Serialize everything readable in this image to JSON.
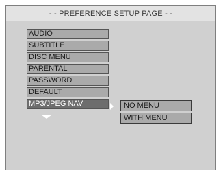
{
  "page_title": "- - PREFERENCE SETUP PAGE - -",
  "menu": {
    "items": [
      {
        "label": "AUDIO"
      },
      {
        "label": "SUBTITLE"
      },
      {
        "label": "DISC MENU"
      },
      {
        "label": "PARENTAL"
      },
      {
        "label": "PASSWORD"
      },
      {
        "label": "DEFAULT"
      },
      {
        "label": "MP3/JPEG NAV"
      }
    ],
    "selected_label": "MP3/JPEG NAV"
  },
  "submenu": {
    "options": [
      {
        "label": "NO MENU"
      },
      {
        "label": "WITH MENU"
      }
    ]
  },
  "icons": {
    "scroll_down": "down-arrow-icon",
    "submenu_indicator": "right-arrow-icon"
  },
  "colors": {
    "background": "#d0d0d0",
    "item": "#aaaaaa",
    "selected_item": "#6d6d6d",
    "selected_text": "#ffffff"
  }
}
